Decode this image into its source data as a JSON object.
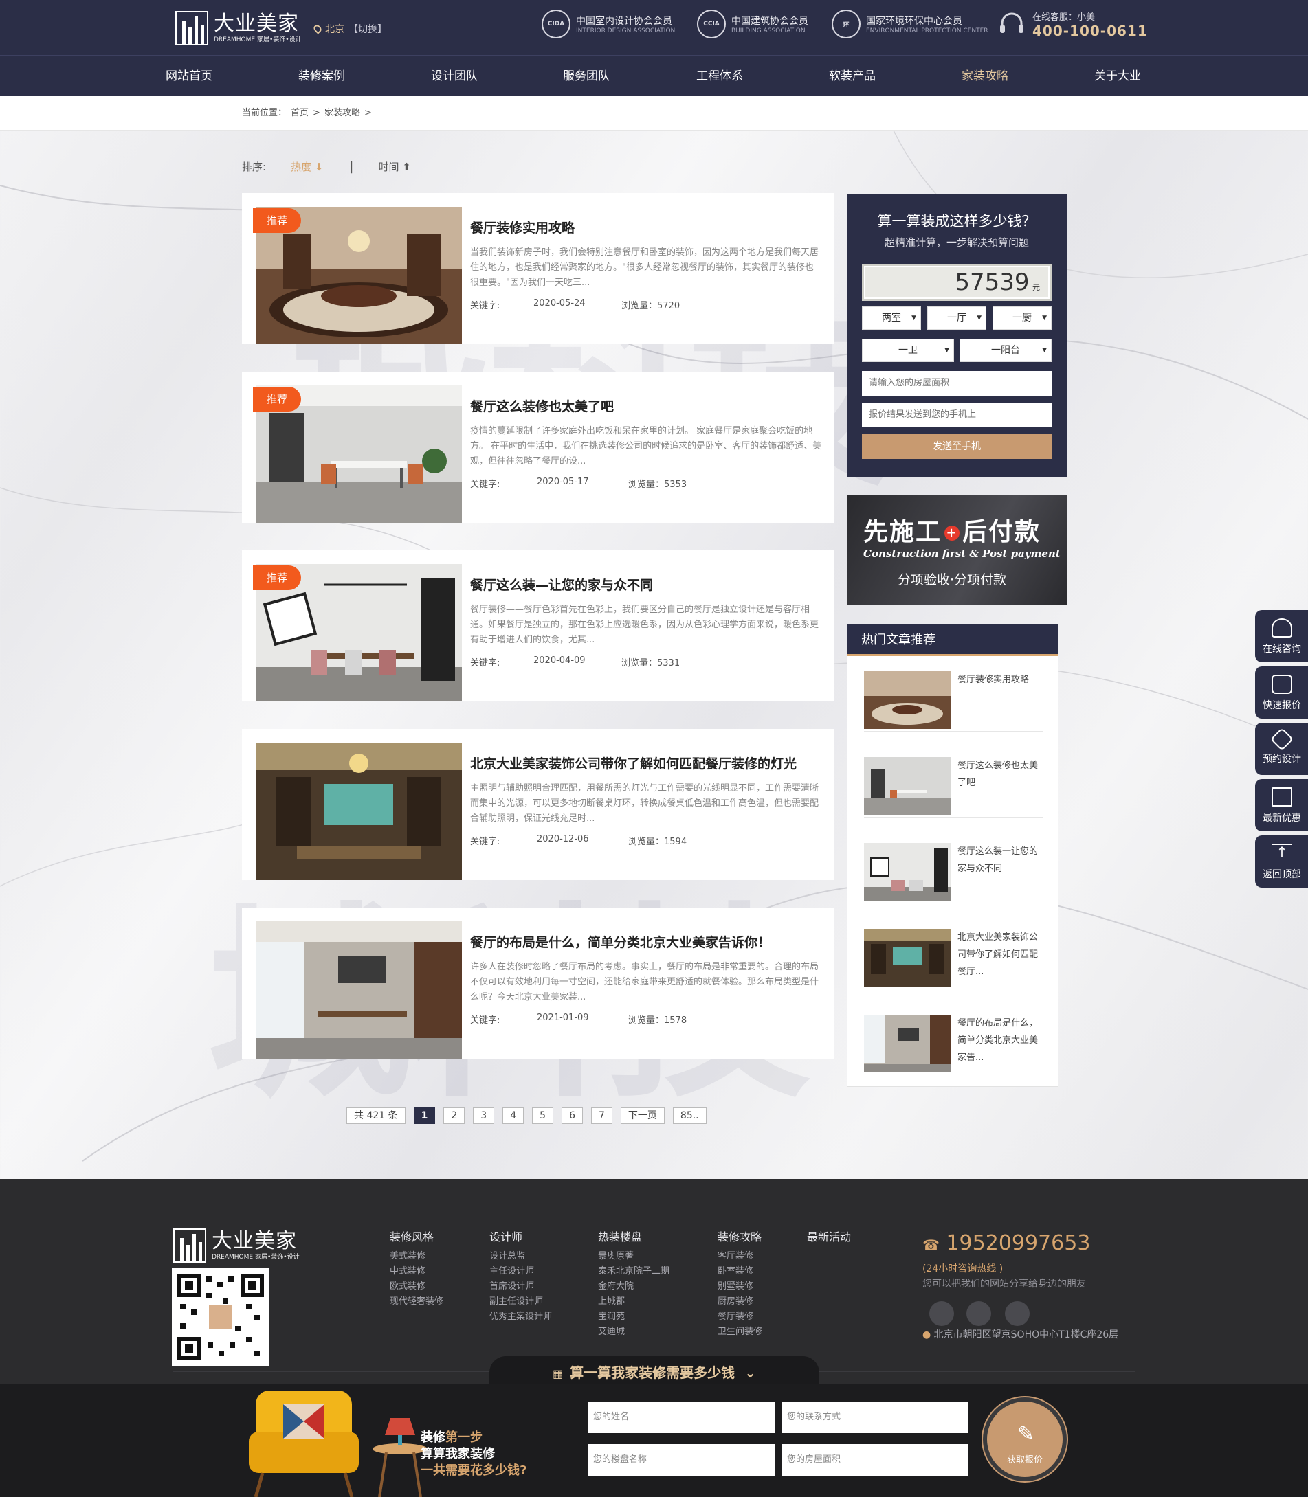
{
  "header": {
    "logo_cn": "大业美家",
    "logo_en": "DREAMHOME 家居•装饰•设计",
    "city": "北京",
    "switch": "【切换】",
    "members": [
      {
        "badge": "CIDA",
        "title": "中国室内设计协会会员",
        "sub": "INTERIOR DESIGN ASSOCIATION"
      },
      {
        "badge": "CCIA",
        "title": "中国建筑协会会员",
        "sub": "BUILDING ASSOCIATION"
      },
      {
        "badge": "环",
        "title": "国家环境环保中心会员",
        "sub": "ENVIRONMENTAL PROTECTION CENTER"
      }
    ],
    "hotline_label": "在线客服：小美",
    "hotline": "400-100-0611"
  },
  "nav": [
    "网站首页",
    "装修案例",
    "设计团队",
    "服务团队",
    "工程体系",
    "软装产品",
    "家装攻略",
    "关于大业"
  ],
  "nav_active": "家装攻略",
  "breadcrumb": {
    "prefix": "当前位置：",
    "home": "首页",
    "sep1": ">",
    "section": "家装攻略",
    "sep2": ">"
  },
  "sort": {
    "label": "排序:",
    "hot": "热度 ⬇",
    "sep": "|",
    "time": "时间 ⬆"
  },
  "watermark": "城科技",
  "articles": [
    {
      "tag": "推荐",
      "title": "餐厅装修实用攻略",
      "desc": "当我们装饰新房子时，我们会特别注意餐厅和卧室的装饰，因为这两个地方是我们每天居住的地方，也是我们经常聚家的地方。\"很多人经常忽视餐厅的装饰，其实餐厅的装修也很重要。\"因为我们一天吃三...",
      "kw_label": "关键字:",
      "date": "2020-05-24",
      "views": "浏览量：5720"
    },
    {
      "tag": "推荐",
      "title": "餐厅这么装修也太美了吧",
      "desc": "疫情的蔓延限制了许多家庭外出吃饭和呆在家里的计划。 家庭餐厅是家庭聚会吃饭的地方。 在平时的生活中，我们在挑选装修公司的时候追求的是卧室、客厅的装饰都舒适、美观，但往往忽略了餐厅的设...",
      "kw_label": "关键字:",
      "date": "2020-05-17",
      "views": "浏览量：5353"
    },
    {
      "tag": "推荐",
      "title": "餐厅这么装—让您的家与众不同",
      "desc": "餐厅装修——餐厅色彩首先在色彩上，我们要区分自己的餐厅是独立设计还是与客厅相通。如果餐厅是独立的，那在色彩上应选暖色系，因为从色彩心理学方面来说，暖色系更有助于增进人们的饮食，尤其...",
      "kw_label": "关键字:",
      "date": "2020-04-09",
      "views": "浏览量：5331"
    },
    {
      "tag": "",
      "title": "北京大业美家装饰公司带你了解如何匹配餐厅装修的灯光",
      "desc": "主照明与辅助照明合理匹配，用餐所需的灯光与工作需要的光线明显不同，工作需要清晰而集中的光源，可以更多地切断餐桌灯环，转换成餐桌低色温和工作高色温，但也需要配合辅助照明，保证光线充足时...",
      "kw_label": "关键字:",
      "date": "2020-12-06",
      "views": "浏览量：1594"
    },
    {
      "tag": "",
      "title": "餐厅的布局是什么，简单分类北京大业美家告诉你！",
      "desc": "许多人在装修时忽略了餐厅布局的考虑。事实上，餐厅的布局是非常重要的。合理的布局不仅可以有效地利用每一寸空间，还能给家庭带来更舒适的就餐体验。那么布局类型是什么呢？今天北京大业美家装...",
      "kw_label": "关键字:",
      "date": "2021-01-09",
      "views": "浏览量：1578"
    }
  ],
  "pagination": {
    "total": "共 421 条",
    "pages": [
      "1",
      "2",
      "3",
      "4",
      "5",
      "6",
      "7"
    ],
    "next": "下一页",
    "last": "85.."
  },
  "quote": {
    "title": "算一算装成这样多少钱？",
    "subtitle": "超精准计算，一步解决预算问题",
    "price": "57539",
    "unit": "元",
    "selects": [
      "两室",
      "一厅",
      "一厨",
      "一卫",
      "一阳台"
    ],
    "area_placeholder": "请输入您的房屋面积",
    "phone_placeholder": "报价结果发送到您的手机上",
    "send": "发送至手机"
  },
  "banner": {
    "line1a": "先施工",
    "plus": "+",
    "line1b": "后付款",
    "line2": "Construction first & Post payment",
    "line3": "分项验收·分项付款"
  },
  "hot": {
    "title": "热门文章推荐",
    "items": [
      "餐厅装修实用攻略",
      "餐厅这么装修也太美了吧",
      "餐厅这么装一让您的家与众不同",
      "北京大业美家装饰公司带你了解如何匹配餐厅...",
      "餐厅的布局是什么，简单分类北京大业美家告..."
    ]
  },
  "float": [
    "在线咨询",
    "快速报价",
    "预约设计",
    "最新优惠",
    "返回顶部"
  ],
  "footer": {
    "logo_cn": "大业美家",
    "logo_en": "DREAMHOME 家居•装饰•设计",
    "cols": [
      {
        "h": "装修风格",
        "items": [
          "美式装修",
          "中式装修",
          "欧式装修",
          "现代轻奢装修"
        ]
      },
      {
        "h": "设计师",
        "items": [
          "设计总监",
          "主任设计师",
          "首席设计师",
          "副主任设计师",
          "优秀主案设计师"
        ]
      },
      {
        "h": "热装楼盘",
        "items": [
          "景奥原著",
          "泰禾北京院子二期",
          "金府大院",
          "上城郡",
          "宝润苑",
          "艾迪城"
        ]
      },
      {
        "h": "装修攻略",
        "items": [
          "客厅装修",
          "卧室装修",
          "别墅装修",
          "厨房装修",
          "餐厅装修",
          "卫生间装修"
        ]
      },
      {
        "h": "最新活动",
        "items": []
      }
    ],
    "phone": "19520997653",
    "note": "(24小时咨询热线 )",
    "share": "您可以把我们的网站分享给身边的朋友",
    "address": "北京市朝阳区望京SOHO中心T1楼C座26层"
  },
  "calc": {
    "tab": "算一算我家装修需要多少钱",
    "tab_hl": "算一算",
    "line1a": "装修",
    "line1b": "第一步",
    "line2": "算算我家装修",
    "line3": "一共需要花多少钱?",
    "name_ph": "您的姓名",
    "contact_ph": "您的联系方式",
    "estate_ph": "您的楼盘名称",
    "area_ph": "您的房屋面积",
    "btn": "获取报价"
  },
  "colors": {
    "navy": "#2b2e47",
    "gold": "#e4c89f",
    "tag": "#f25a1d",
    "button": "#c89a70"
  }
}
